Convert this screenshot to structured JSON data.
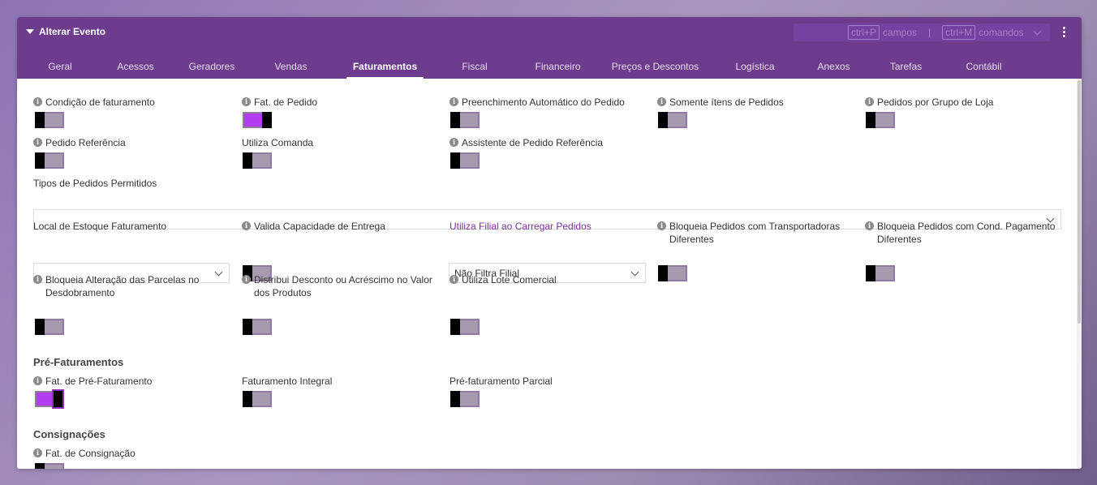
{
  "header": {
    "title": "Alterar Evento",
    "shortcut_fields_key": "ctrl+P",
    "shortcut_fields_label": "campos",
    "shortcut_separator": "|",
    "shortcut_commands_key": "ctrl+M",
    "shortcut_commands_label": "comandos"
  },
  "tabs": [
    "Geral",
    "Acessos",
    "Geradores",
    "Vendas",
    "Faturamentos",
    "Fiscal",
    "Financeiro",
    "Preços e Descontos",
    "Logística",
    "Anexos",
    "Tarefas",
    "Contábil"
  ],
  "active_tab": "Faturamentos",
  "fields": {
    "condicao_faturamento": "Condição de faturamento",
    "fat_pedido": "Fat. de Pedido",
    "preenchimento_automatico": "Preenchimento Automático do Pedido",
    "somente_itens": "Somente ítens de Pedidos",
    "pedidos_grupo_loja": "Pedidos por Grupo de Loja",
    "pedido_referencia": "Pedido Referência",
    "utiliza_comanda": "Utiliza Comanda",
    "assistente_pedido_ref": "Assistente de Pedido Referência",
    "tipos_pedidos_permitidos": "Tipos de Pedidos Permitidos",
    "local_estoque": "Local de Estoque Faturamento",
    "valida_capacidade": "Valida Capacidade de Entrega",
    "utiliza_filial": "Utiliza Filial ao Carregar Pedidos",
    "utiliza_filial_value": "Não Filtra Filial",
    "bloqueia_transportadoras": "Bloqueia Pedidos com Transportadoras Diferentes",
    "bloqueia_cond_pagamento": "Bloqueia Pedidos com Cond. Pagamento Diferentes",
    "bloqueia_parcelas": "Bloqueia Alteração das Parcelas no Desdobramento",
    "distribui_desconto": "Distribui Desconto ou Acréscimo no Valor dos Produtos",
    "utiliza_lote": "Utiliza Lote Comercial"
  },
  "sections": {
    "pre_faturamentos": "Pré-Faturamentos",
    "consignacoes": "Consignações"
  },
  "pre_fields": {
    "fat_pre_faturamento": "Fat. de Pré-Faturamento",
    "faturamento_integral": "Faturamento Integral",
    "pre_faturamento_parcial": "Pré-faturamento Parcial"
  },
  "cons_fields": {
    "fat_consignacao": "Fat. de Consignação"
  },
  "toggle_states": {
    "condicao_faturamento": false,
    "fat_pedido": true,
    "preenchimento_automatico": false,
    "somente_itens": false,
    "pedidos_grupo_loja": false,
    "pedido_referencia": false,
    "utiliza_comanda": false,
    "assistente_pedido_ref": false,
    "valida_capacidade": false,
    "bloqueia_transportadoras": false,
    "bloqueia_cond_pagamento": false,
    "bloqueia_parcelas": false,
    "distribui_desconto": false,
    "utiliza_lote": false,
    "fat_pre_faturamento": true,
    "faturamento_integral": false,
    "pre_faturamento_parcial": false,
    "fat_consignacao": false
  },
  "colors": {
    "header": "#6d3c8d",
    "toggle_on": "#b43cf0",
    "accent_label": "#7d2e9e"
  },
  "info_icon_glyph": "i"
}
